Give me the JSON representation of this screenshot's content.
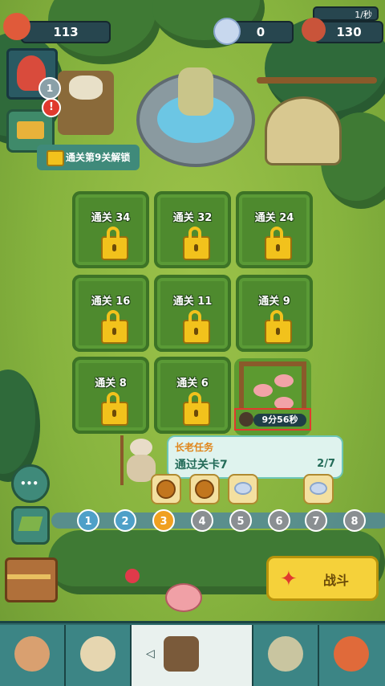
{
  "resources": {
    "power": "113",
    "crystals": "0",
    "meat": "130",
    "meat_rate": "1/秒"
  },
  "player": {
    "level": "1",
    "alert": "!"
  },
  "unlock_tip": "通关第9关解锁",
  "plots": [
    {
      "label": "通关 34"
    },
    {
      "label": "通关 32"
    },
    {
      "label": "通关 24"
    },
    {
      "label": "通关 16"
    },
    {
      "label": "通关 11"
    },
    {
      "label": "通关 9"
    },
    {
      "label": "通关 8"
    },
    {
      "label": "通关 6"
    }
  ],
  "pen": {
    "timer": "9分56秒"
  },
  "quest": {
    "title": "长老任务",
    "description": "通过关卡7",
    "progress": "2/7"
  },
  "stages": [
    {
      "number": "1",
      "state": "done"
    },
    {
      "number": "2",
      "state": "done"
    },
    {
      "number": "3",
      "state": "current"
    },
    {
      "number": "4",
      "state": "locked"
    },
    {
      "number": "5",
      "state": "locked"
    },
    {
      "number": "6",
      "state": "locked"
    },
    {
      "number": "7",
      "state": "locked"
    },
    {
      "number": "8",
      "state": "locked"
    }
  ],
  "fight_button": "战斗",
  "colors": {
    "accent_gold": "#f5d13a",
    "panel_teal": "#27464f",
    "alert_red": "#e03a2e",
    "grass": "#86b33e"
  }
}
